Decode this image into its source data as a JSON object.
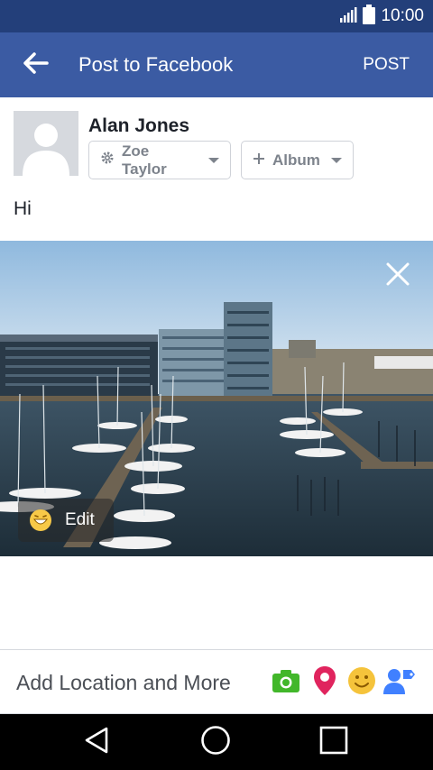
{
  "status_bar": {
    "time": "10:00",
    "signal_icon": "signal-icon",
    "battery_icon": "battery-icon"
  },
  "app_bar": {
    "title": "Post to Facebook",
    "post_label": "POST",
    "back_icon": "back-arrow-icon"
  },
  "composer": {
    "user_name": "Alan Jones",
    "audience_label": "Zoe Taylor",
    "album_label": "Album",
    "post_text": "Hi"
  },
  "photo": {
    "edit_label": "Edit"
  },
  "bottom_bar": {
    "add_more_label": "Add Location and More"
  },
  "colors": {
    "status_bar": "#233f7a",
    "app_bar": "#3b5ba3",
    "photo_icon": "#42b72a",
    "location_icon": "#e0245e",
    "feeling_icon": "#f5c33b",
    "tag_icon": "#4080ff"
  }
}
